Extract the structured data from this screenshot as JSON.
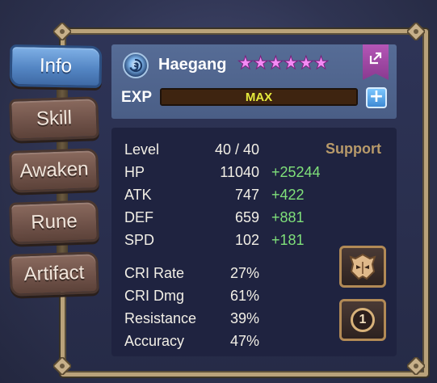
{
  "tabs": [
    {
      "label": "Info",
      "active": true
    },
    {
      "label": "Skill",
      "active": false
    },
    {
      "label": "Awaken",
      "active": false
    },
    {
      "label": "Rune",
      "active": false
    },
    {
      "label": "Artifact",
      "active": false
    }
  ],
  "monster": {
    "name": "Haegang",
    "stars": 6,
    "star_glyph": "★",
    "attribute_icon": "water-swirl-icon"
  },
  "exp": {
    "label": "EXP",
    "value_text": "MAX",
    "fill_fraction": 1.0
  },
  "plus_glyph": "+",
  "role": "Support",
  "level": {
    "label": "Level",
    "value": "40 / 40"
  },
  "base_stats": [
    {
      "label": "HP",
      "value": "11040",
      "bonus": "+25244"
    },
    {
      "label": "ATK",
      "value": "747",
      "bonus": "+422"
    },
    {
      "label": "DEF",
      "value": "659",
      "bonus": "+881"
    },
    {
      "label": "SPD",
      "value": "102",
      "bonus": "+181"
    }
  ],
  "secondary_stats": [
    {
      "label": "CRI Rate",
      "value": "27%"
    },
    {
      "label": "CRI Dmg",
      "value": "61%"
    },
    {
      "label": "Resistance",
      "value": "39%"
    },
    {
      "label": "Accuracy",
      "value": "47%"
    }
  ],
  "side_buttons": {
    "helmet_icon": "mask-helmet-icon",
    "badge_number": "1"
  },
  "colors": {
    "bonus_green": "#7fe07a",
    "role_gold": "#b89a6a",
    "star_pink": "#f48bf5",
    "active_tab_blue": "#5486c4",
    "share_purple": "#a04aa6"
  }
}
